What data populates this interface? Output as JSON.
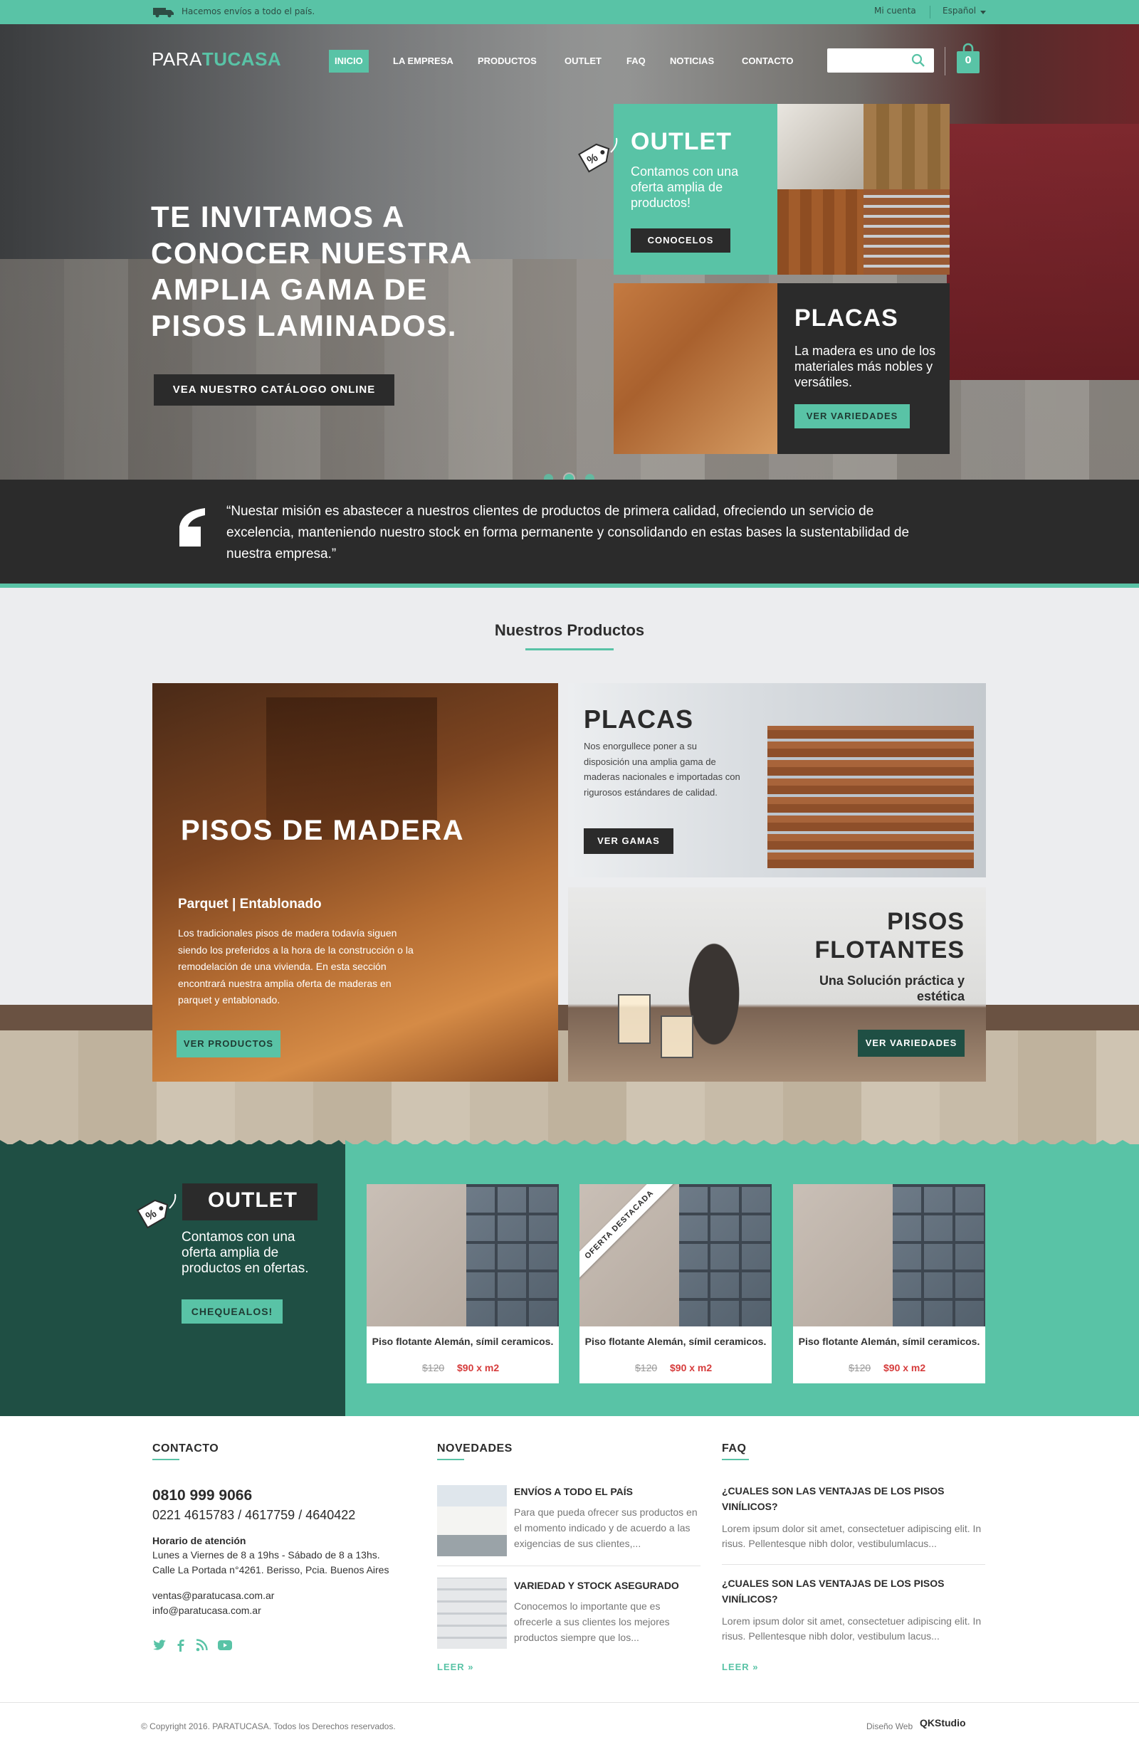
{
  "colors": {
    "accent": "#59c3a6",
    "dark": "#2b2b2b",
    "deep_green": "#1f4f44",
    "price_red": "#d63c3c"
  },
  "topbar": {
    "shipping": "Hacemos envíos a todo el país.",
    "account": "Mi cuenta",
    "language": "Español"
  },
  "header": {
    "logo_part1": "PARA",
    "logo_part2": "TUCASA",
    "nav": [
      "INICIO",
      "LA EMPRESA",
      "PRODUCTOS",
      "OUTLET",
      "FAQ",
      "NOTICIAS",
      "CONTACTO"
    ],
    "active_nav": "INICIO",
    "search_placeholder": "",
    "cart_count": "0"
  },
  "hero": {
    "headline": "TE INVITAMOS A CONOCER NUESTRA AMPLIA GAMA DE PISOS LAMINADOS.",
    "cta": "VEA NUESTRO CATÁLOGO ONLINE",
    "outlet_card": {
      "title": "OUTLET",
      "text": "Contamos con una oferta amplia de productos!",
      "button": "CONOCELOS"
    },
    "placas_card": {
      "title": "PLACAS",
      "text": "La madera es uno de los materiales más nobles y versátiles.",
      "button": "VER VARIEDADES"
    },
    "slides": 3,
    "active_slide": 2
  },
  "mission": {
    "text": "“Nuestar misión es abastecer a nuestros clientes de productos de primera calidad, ofreciendo un servicio de excelencia, manteniendo nuestro stock en forma permanente y consolidando en estas bases la sustentabilidad de nuestra empresa.”"
  },
  "products": {
    "heading": "Nuestros Productos",
    "madera": {
      "title": "PISOS DE MADERA",
      "subtitle": "Parquet | Entablonado",
      "text": "Los tradicionales pisos de madera todavía siguen siendo los preferidos a la hora de la construcción o la remodelación de una vivienda. En esta sección encontrará nuestra amplia oferta de maderas en parquet y entablonado.",
      "button": "VER PRODUCTOS"
    },
    "placas": {
      "title": "PLACAS",
      "text": "Nos enorgullece poner a su disposición una amplia gama de maderas nacionales e importadas con rigurosos estándares de calidad.",
      "button": "VER GAMAS"
    },
    "flotantes": {
      "title": "PISOS FLOTANTES",
      "subtitle": "Una Solución práctica y estética",
      "button": "VER VARIEDADES"
    }
  },
  "outlet": {
    "title": "OUTLET",
    "text": "Contamos con una oferta amplia de productos en ofertas.",
    "button": "CHEQUEALOS!",
    "ribbon": "OFERTA DESTACADA",
    "items": [
      {
        "name": "Piso flotante Alemán, símil ceramicos.",
        "old_price": "$120",
        "price": "$90 x m2"
      },
      {
        "name": "Piso flotante Alemán, símil ceramicos.",
        "old_price": "$120",
        "price": "$90 x m2"
      },
      {
        "name": "Piso flotante Alemán, símil ceramicos.",
        "old_price": "$120",
        "price": "$90 x m2"
      }
    ]
  },
  "footer": {
    "contact": {
      "heading": "CONTACTO",
      "phone_main": "0810 999 9066",
      "phones": "0221 4615783 / 4617759 / 4640422",
      "hours_label": "Horario de atención",
      "hours": "Lunes a Viernes de 8 a 19hs - Sábado de 8 a 13hs.",
      "address": "Calle La Portada n°4261. Berisso, Pcia. Buenos Aires",
      "email1": "ventas@paratucasa.com.ar",
      "email2": "info@paratucasa.com.ar",
      "social": [
        "twitter-icon",
        "facebook-icon",
        "rss-icon",
        "youtube-icon"
      ]
    },
    "news": {
      "heading": "NOVEDADES",
      "items": [
        {
          "title": "ENVÍOS A TODO EL PAÍS",
          "text": "Para que pueda ofrecer sus productos en el momento indicado y de acuerdo a las exigencias de sus clientes,..."
        },
        {
          "title": "VARIEDAD Y STOCK ASEGURADO",
          "text": "Conocemos lo importante que es ofrecerle a sus clientes los mejores productos siempre que los..."
        }
      ],
      "more": "LEER »"
    },
    "faq": {
      "heading": "FAQ",
      "items": [
        {
          "q": "¿CUALES SON LAS VENTAJAS DE LOS PISOS VINÍLICOS?",
          "a": "Lorem ipsum dolor sit amet, consectetuer adipiscing elit. In risus. Pellentesque nibh dolor, vestibulumlacus..."
        },
        {
          "q": "¿CUALES SON LAS VENTAJAS DE LOS PISOS VINÍLICOS?",
          "a": "Lorem ipsum dolor sit amet, consectetuer adipiscing elit. In risus. Pellentesque nibh dolor, vestibulum lacus..."
        }
      ],
      "more": "LEER »"
    },
    "copyright": "© Copyright 2016. PARATUCASA. Todos los Derechos reservados.",
    "design_label": "Diseño Web",
    "design_studio": "QKStudio"
  }
}
